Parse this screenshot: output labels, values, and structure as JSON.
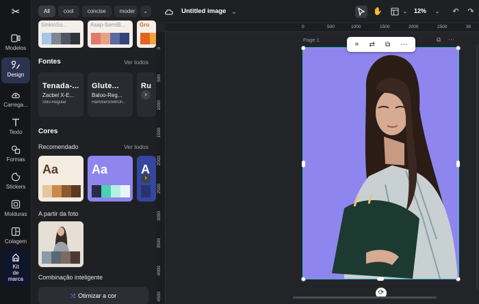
{
  "rail": {
    "logo": "✂",
    "items": [
      {
        "label": "Modelos"
      },
      {
        "label": "Design"
      },
      {
        "label": "Carrega..."
      },
      {
        "label": "Texto"
      },
      {
        "label": "Formas"
      },
      {
        "label": "Stickers"
      },
      {
        "label": "Molduras"
      },
      {
        "label": "Colagem"
      }
    ],
    "brand": {
      "line1": "Kit",
      "line2": "de",
      "line3": "marca"
    }
  },
  "filters": {
    "chips": [
      "All",
      "cool",
      "concise",
      "moder"
    ],
    "more": "⌄"
  },
  "font_thumbs": [
    {
      "title": "SinkinSo...",
      "swatches": [
        "#a8c6e6",
        "#7d8794",
        "#4d5661",
        "#2f3439"
      ]
    },
    {
      "title": "Asap-SemiB...",
      "swatches": [
        "#e27a6b",
        "#e6a384",
        "#5a6aa3",
        "#33447a"
      ]
    },
    {
      "title": "Gro",
      "swatches": [
        "#e2641f",
        "#f2a33a"
      ]
    }
  ],
  "fonts": {
    "title": "Fontes",
    "see_all": "Ver todos",
    "cards": [
      {
        "a": "Tenada-...",
        "b": "Zacbel X-E...",
        "c": "Stilu-Regular"
      },
      {
        "a": "Glute...",
        "b": "Baloo-Reg...",
        "c": "HammersmithOn..."
      },
      {
        "a": "Ru",
        "b": "",
        "c": ""
      }
    ],
    "next": "›"
  },
  "colors": {
    "title": "Cores",
    "recommended": "Recomendado",
    "see_all": "Ver todos",
    "cards": [
      {
        "aa": "Aa",
        "bg": "#f4ece1",
        "fg": "#5a3a22",
        "swatches": [
          "#e8c69c",
          "#c88b4e",
          "#8a5a2e",
          "#5a3a22"
        ]
      },
      {
        "aa": "Aa",
        "bg": "#8e86ee",
        "fg": "#ffffff",
        "swatches": [
          "#2d2a48",
          "#48d1b5",
          "#b5f0e6",
          "#e8f7f4"
        ]
      },
      {
        "aa": "A",
        "bg": "#3446a0",
        "fg": "#ffffff",
        "swatches": [
          "#2a3470"
        ]
      }
    ],
    "next": "›"
  },
  "from_photo": {
    "title": "A partir da foto",
    "swatches": [
      "#8b9aa8",
      "#5a6873",
      "#7b6a5e",
      "#4a3a33"
    ]
  },
  "smart": {
    "title": "Combinação inteligente",
    "button": "Otimizar a cor"
  },
  "topbar": {
    "title": "Untitled image",
    "zoom": "12%"
  },
  "canvas": {
    "ruler_top": [
      "0",
      "500",
      "1000",
      "1500",
      "2000",
      "2500",
      "30"
    ],
    "ruler_left": [
      "0",
      "500",
      "1000",
      "1500",
      "2000",
      "2500",
      "3000",
      "3500",
      "4000",
      "4500"
    ],
    "page_label": "Page 1",
    "artboard_color": "#8f85ef",
    "selection_color": "#33b7d9"
  }
}
